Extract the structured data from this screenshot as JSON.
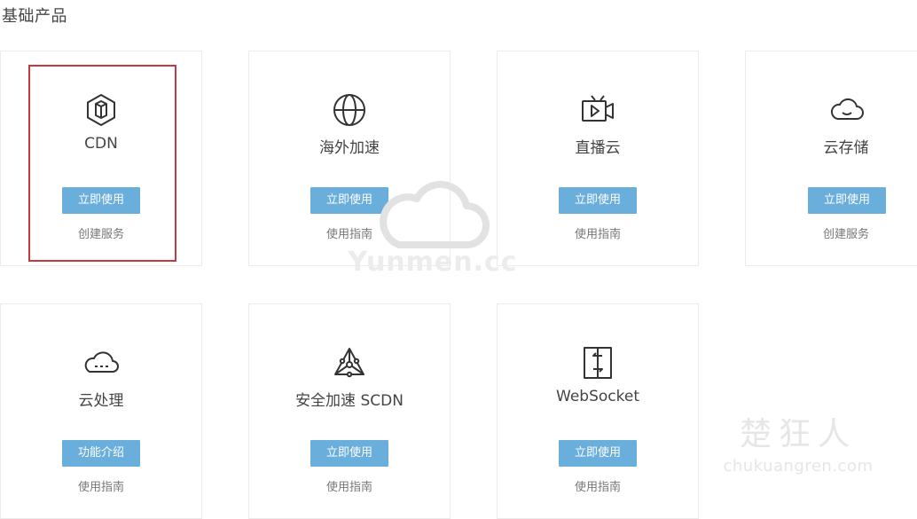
{
  "section": {
    "title": "基础产品"
  },
  "cards": [
    {
      "name": "CDN",
      "button": "立即使用",
      "link": "创建服务",
      "icon": "cdn-box-icon"
    },
    {
      "name": "海外加速",
      "button": "立即使用",
      "link": "使用指南",
      "icon": "globe-icon"
    },
    {
      "name": "直播云",
      "button": "立即使用",
      "link": "使用指南",
      "icon": "live-tv-icon"
    },
    {
      "name": "云存储",
      "button": "立即使用",
      "link": "创建服务",
      "icon": "cloud-icon"
    },
    {
      "name": "云处理",
      "button": "功能介绍",
      "link": "使用指南",
      "icon": "cloud-process-icon"
    },
    {
      "name": "安全加速 SCDN",
      "button": "立即使用",
      "link": "使用指南",
      "icon": "network-triangle-icon"
    },
    {
      "name": "WebSocket",
      "button": "立即使用",
      "link": "使用指南",
      "icon": "websocket-icon"
    }
  ],
  "watermarks": {
    "center": "Yunmen.cc",
    "corner_cn": "楚狂人",
    "corner_en": "chukuangren.com"
  },
  "colors": {
    "button": "#6aaedb",
    "selected_border": "#c6393c",
    "card_border": "#ebebeb"
  }
}
